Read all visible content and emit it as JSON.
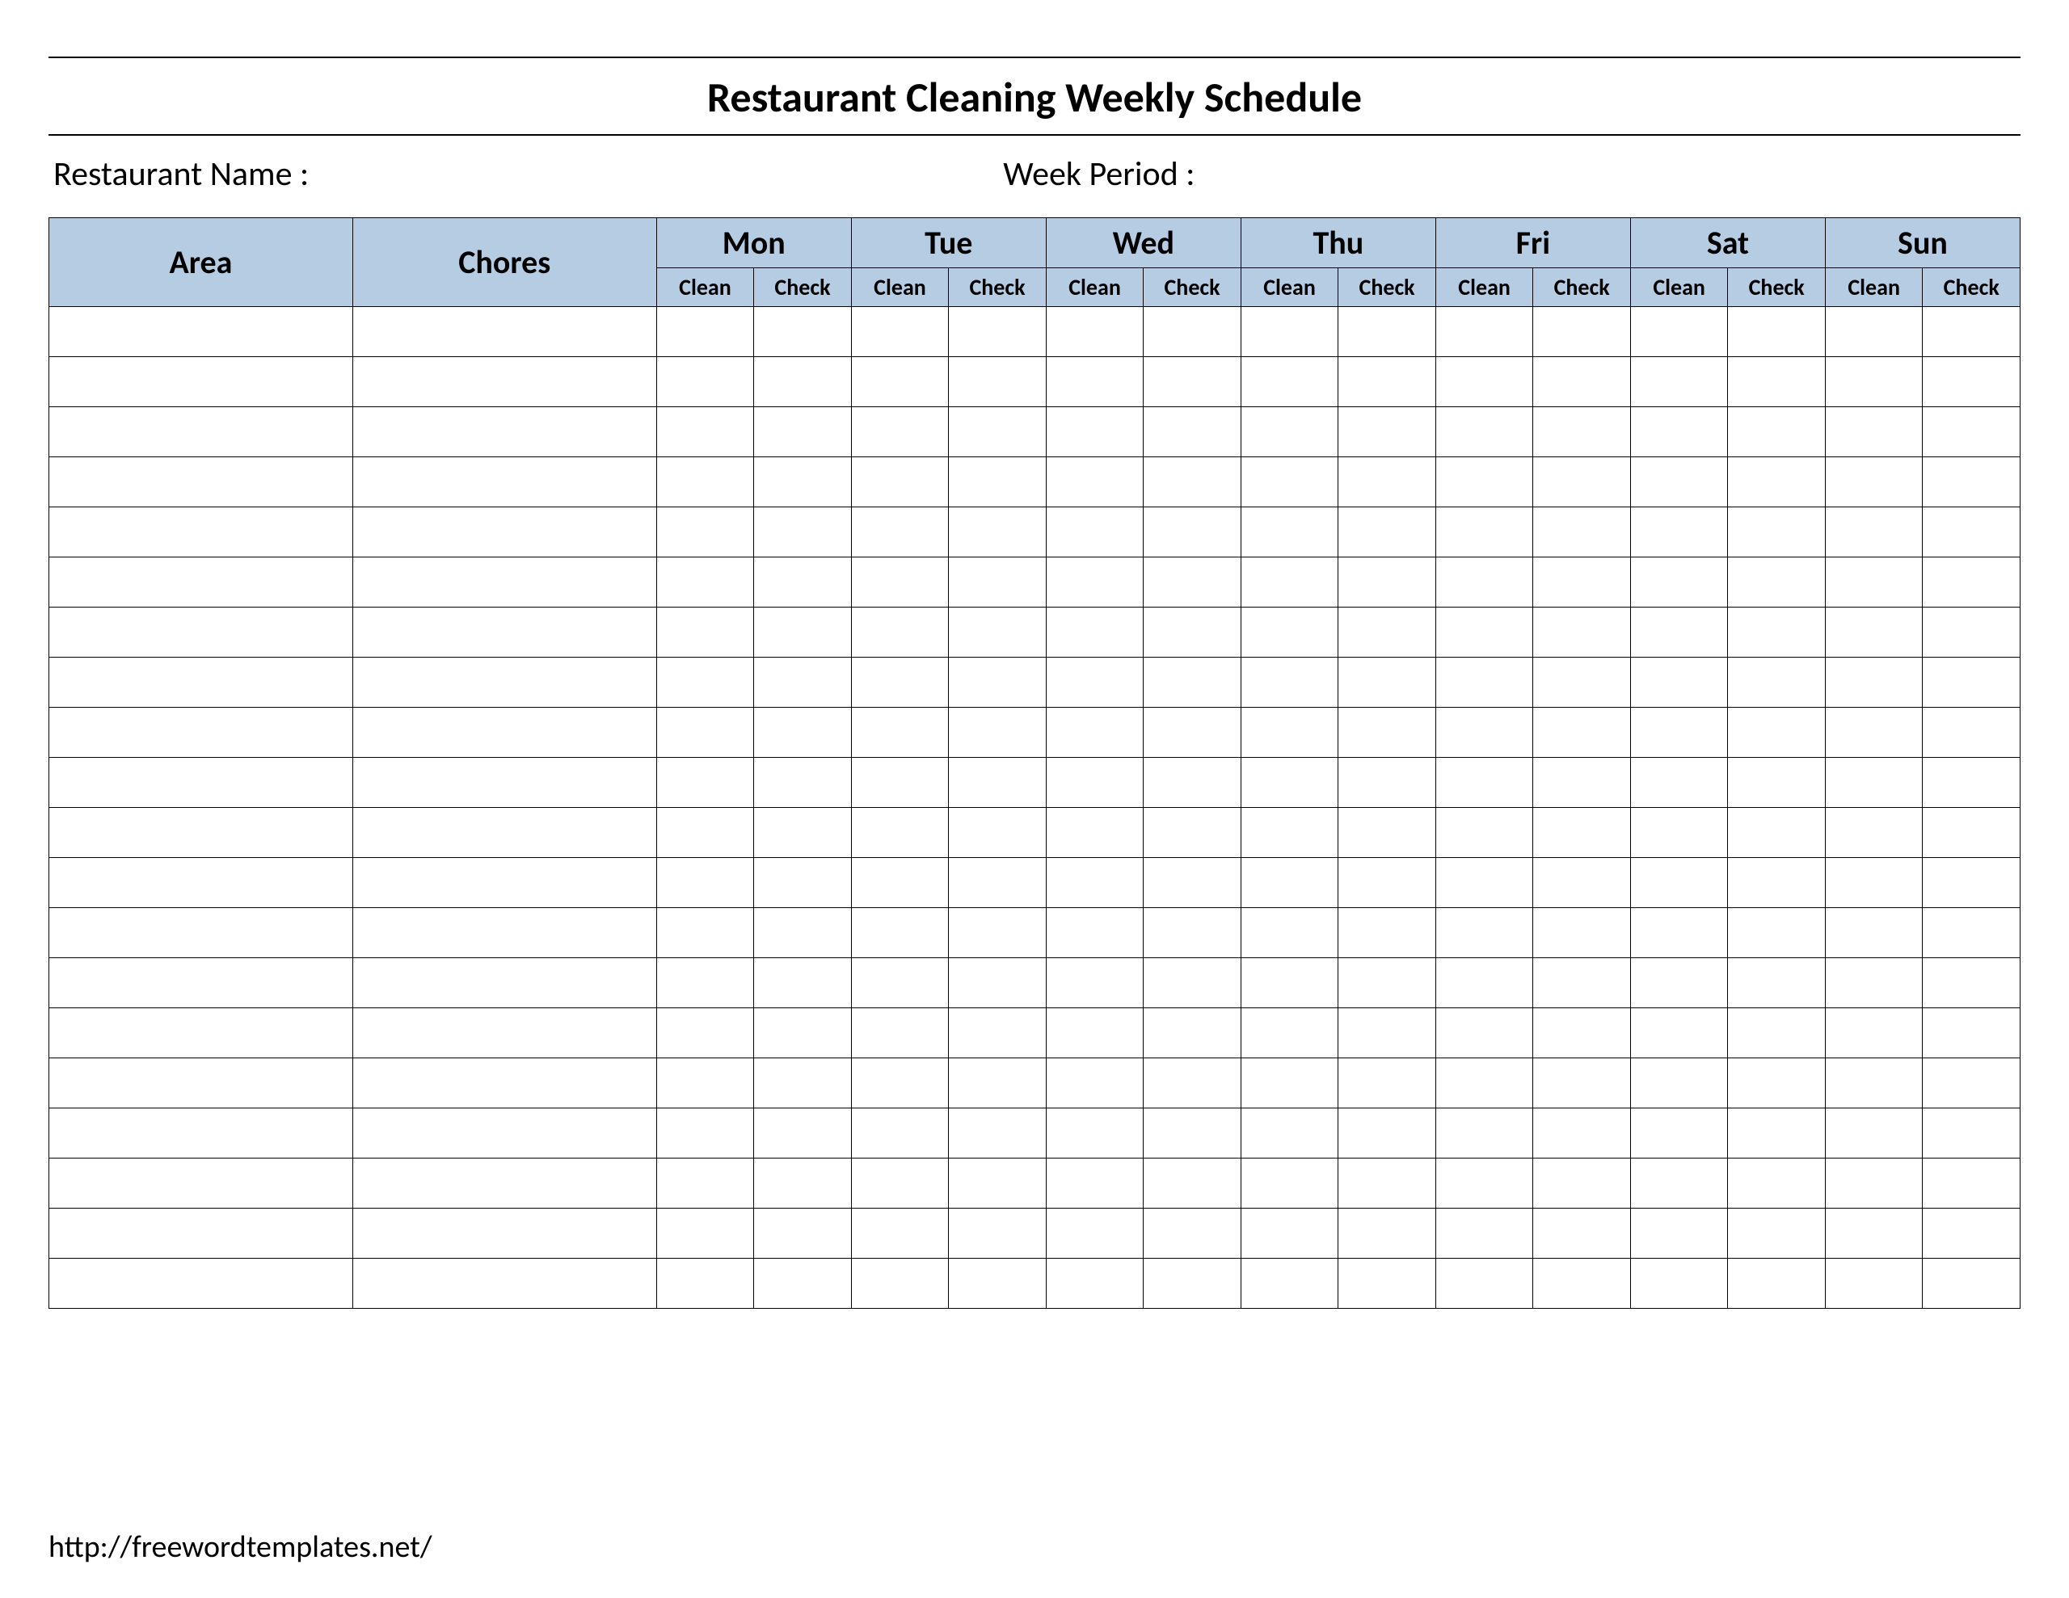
{
  "header": {
    "title": "Restaurant Cleaning Weekly Schedule",
    "restaurant_label": "Restaurant Name   :",
    "week_period_label": "Week  Period :"
  },
  "columns": {
    "area": "Area",
    "chores": "Chores",
    "days": [
      "Mon",
      "Tue",
      "Wed",
      "Thu",
      "Fri",
      "Sat",
      "Sun"
    ],
    "sub": {
      "clean": "Clean",
      "check": "Check"
    }
  },
  "rows_count": 20,
  "footer": {
    "url": "http://freewordtemplates.net/"
  }
}
